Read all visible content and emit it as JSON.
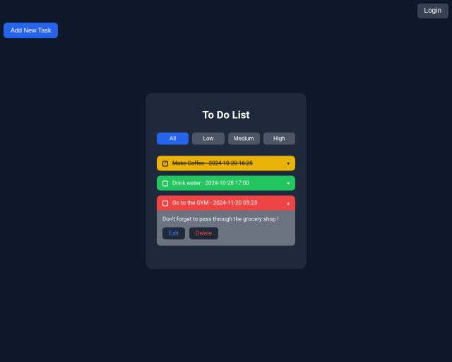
{
  "header": {
    "login_label": "Login",
    "add_task_label": "Add New Task"
  },
  "card": {
    "title": "To Do List"
  },
  "filters": {
    "all": "All",
    "low": "Low",
    "medium": "Medium",
    "high": "High",
    "active": "all"
  },
  "tasks": [
    {
      "title": "Make Coffee",
      "date": "2024-10-20 16:25",
      "priority": "low",
      "done": true,
      "expanded": false
    },
    {
      "title": "Drink water",
      "date": "2024-10-28 17:00",
      "priority": "medium",
      "done": false,
      "expanded": false
    },
    {
      "title": "Go to the GYM",
      "date": "2024-11-20 05:23",
      "priority": "high",
      "done": false,
      "expanded": true,
      "description": "Don't forget to pass through the grocery shop !",
      "edit_label": "Edit",
      "delete_label": "Delete"
    }
  ],
  "separator": " - "
}
